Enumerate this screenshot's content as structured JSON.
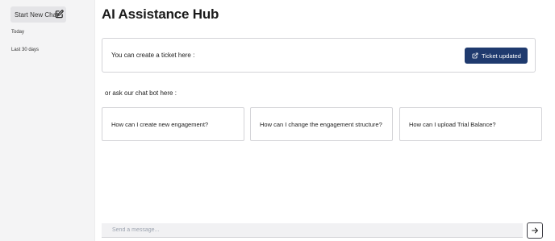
{
  "sidebar": {
    "new_chat_label": "Start New Chat",
    "new_chat_icon": "edit-icon",
    "sections": [
      {
        "label": "Today"
      },
      {
        "label": "Last 30 days"
      }
    ]
  },
  "main": {
    "title": "AI Assistance Hub",
    "ticket": {
      "text": "You can create a ticket here :",
      "button_label": "Ticket updated",
      "button_icon": "external-link-icon",
      "button_color": "#1f3a6e"
    },
    "bot_prompt": "or ask our chat bot here :",
    "suggestions": [
      {
        "label": "How can I create new engagement?"
      },
      {
        "label": "How can I change the engagement structure?"
      },
      {
        "label": "How can I upload Trial Balance?"
      }
    ],
    "composer": {
      "placeholder": "Send a message...",
      "value": "",
      "send_icon": "arrow-right-icon"
    }
  }
}
